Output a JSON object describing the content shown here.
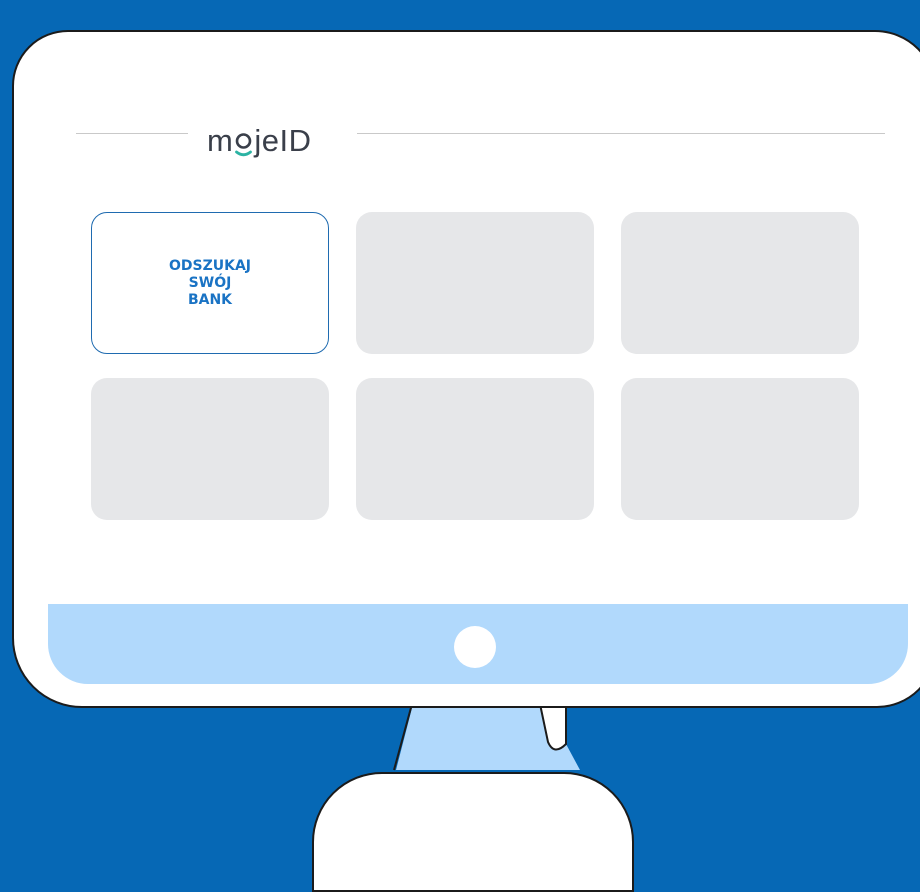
{
  "brand": {
    "logo_text_left": "m",
    "logo_text_right": "jeID",
    "logo_accent_color": "#2bb3a3"
  },
  "tiles": {
    "primary_label": "ODSZUKAJ\nSWÓJ\nBANK"
  },
  "colors": {
    "background": "#0668b5",
    "accent": "#1a73c4",
    "placeholder": "#e6e7e9",
    "chin": "#b1d9fc"
  }
}
